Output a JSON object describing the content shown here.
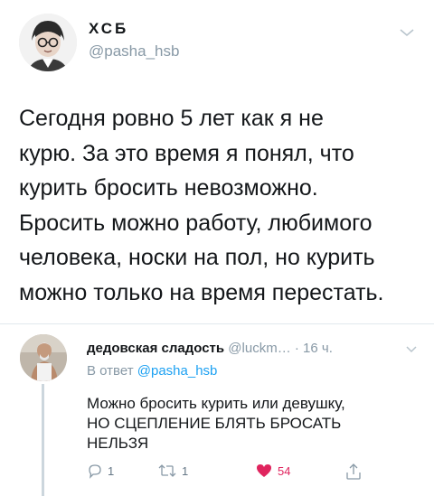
{
  "tweet": {
    "display_name": "ХСБ",
    "handle": "@pasha_hsb",
    "text": "Сегодня ровно 5 лет как я не\nкурю. За это время я понял, что\nкурить бросить невозможно.\nБросить можно работу, любимого\nчеловека, носки на пол, но курить\nможно только на время перестать."
  },
  "reply": {
    "display_name": "дедовская сладость",
    "meta": "@luckm… · 16 ч.",
    "reply_to_prefix": "В ответ",
    "reply_to_handle": "@pasha_hsb",
    "text": "Можно бросить курить или девушку,\nНО СЦЕПЛЕНИЕ БЛЯТЬ БРОСАТЬ\nНЕЛЬЗЯ",
    "actions": {
      "replies": "1",
      "retweets": "1",
      "likes": "54"
    }
  },
  "colors": {
    "muted": "#8899a6",
    "link": "#1da1f2",
    "like": "#e0245e",
    "divider": "#e1e8ed"
  },
  "icons": [
    "chevron-down-icon",
    "reply-icon",
    "retweet-icon",
    "heart-icon",
    "share-icon"
  ]
}
